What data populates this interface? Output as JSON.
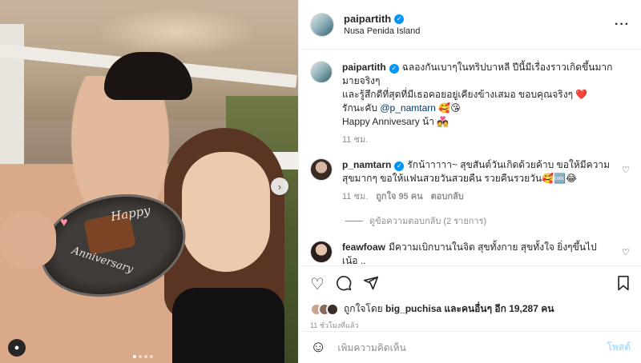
{
  "post": {
    "username": "paipartith",
    "location": "Nusa Penida Island",
    "more_icon": "more-dots-icon"
  },
  "photo": {
    "plate_text_1": "Happy",
    "plate_text_2": "Anniversary",
    "carousel_total": 4,
    "carousel_active": 1
  },
  "caption": {
    "username": "paipartith",
    "line1": "ฉลองกันเบาๆในทริปบาหลี ปีนี้มีเรื่องราวเกิดขึ้นมากมายจริงๆ",
    "line2": "และรู้สึกดีที่สุดที่มีเธอคอยอยู่เคียงข้างเสมอ ขอบคุณจริงๆ",
    "line2_emoji": "❤️",
    "line3_prefix": "รักนะคับ",
    "mention": "@p_namtarn",
    "line3_emoji": "🥰😘",
    "line4": "Happy Annivesary น้า",
    "line4_emoji": "💑",
    "time": "11 ชม."
  },
  "comments": [
    {
      "username": "p_namtarn",
      "text": "รักน้าาาาา~ สุขสันต์วันเกิดด้วยค้าบ ขอให้มีความสุขมากๆ ขอให้แฟนสวยวันสวยคืน รวยคืนรวยวัน🥰🆒😂",
      "time": "11 ชม.",
      "likes": "ถูกใจ 95 คน",
      "reply": "ตอบกลับ",
      "view_replies": "ดูข้อความตอบกลับ (2 รายการ)"
    },
    {
      "username": "feawfoaw",
      "text": "มีความเบิกบานในจิต สุขทั้งกาย สุขทั้งใจ ยิ่งๆขึ้นไปเน้อ ..",
      "time": "",
      "likes": "",
      "reply": ""
    }
  ],
  "likes": {
    "prefix": "ถูกใจโดย",
    "user": "big_puchisa",
    "middle": "และคนอื่นๆ อีก",
    "count": "19,287",
    "suffix": "คน",
    "time": "11 ชั่วโมงที่แล้ว"
  },
  "add_comment": {
    "placeholder": "เพิ่มความคิดเห็น",
    "post_label": "โพสต์"
  }
}
